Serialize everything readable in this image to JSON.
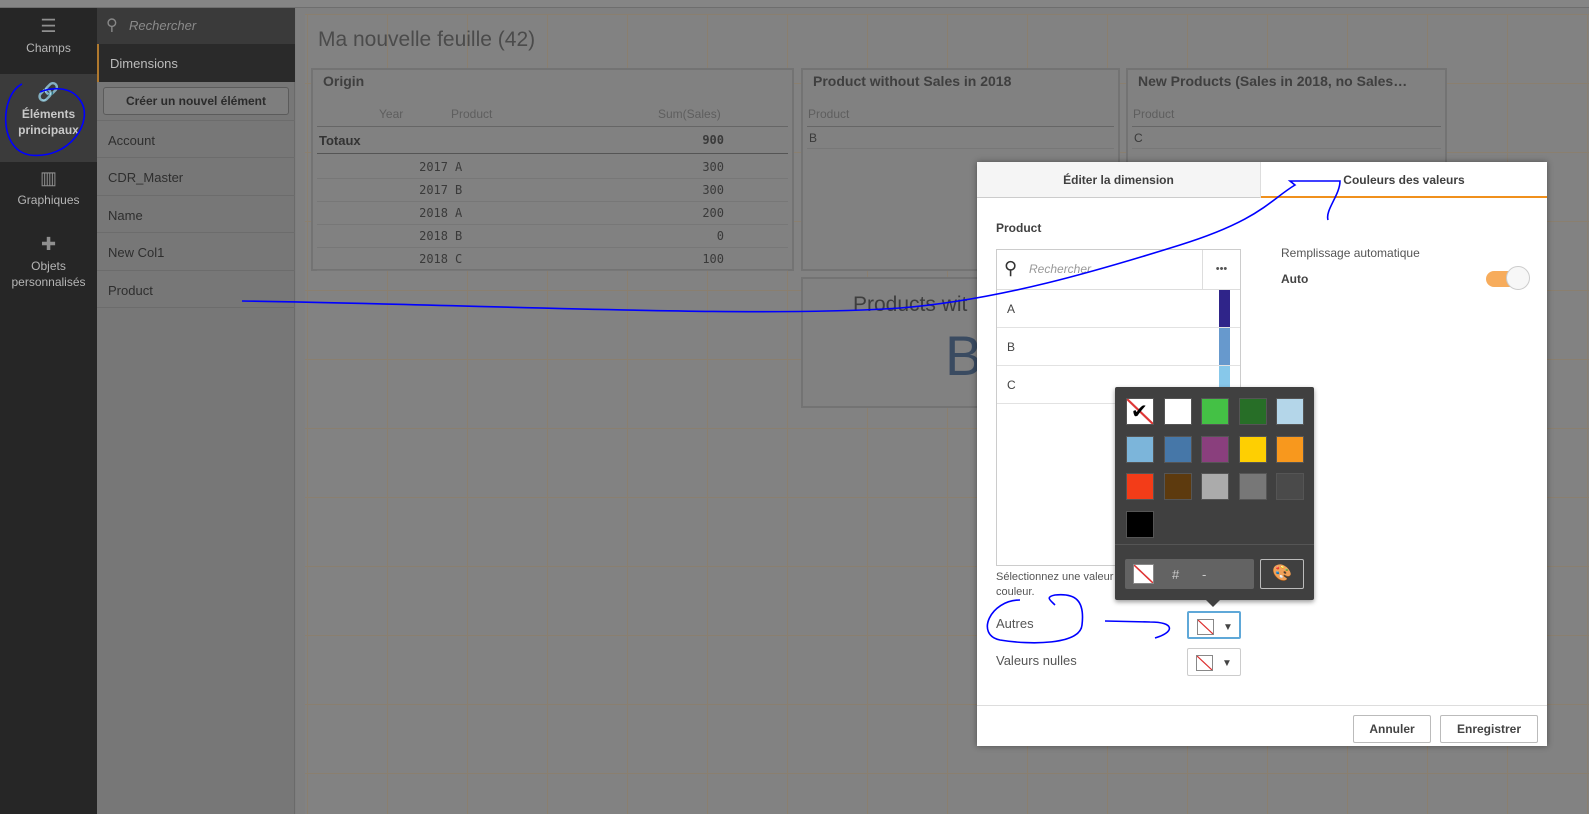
{
  "sidebar": {
    "items": [
      {
        "label": "Champs",
        "icon": "database-icon"
      },
      {
        "label": "Éléments principaux",
        "icon": "link-icon",
        "selected": true
      },
      {
        "label": "Graphiques",
        "icon": "bar-chart-icon"
      },
      {
        "label": "Objets personnalisés",
        "icon": "puzzle-icon"
      }
    ]
  },
  "panel": {
    "search_placeholder": "Rechercher",
    "section": "Dimensions",
    "create_label": "Créer un nouvel élément",
    "items": [
      "Account",
      "CDR_Master",
      "Name",
      "New Col1",
      "Product"
    ]
  },
  "sheet": {
    "title": "Ma nouvelle feuille (42)"
  },
  "origin": {
    "title": "Origin",
    "headers": [
      "Year",
      "Product",
      "Sum(Sales)"
    ],
    "totals_label": "Totaux",
    "totals_value": "900",
    "rows": [
      [
        "2017",
        "A",
        "300"
      ],
      [
        "2017",
        "B",
        "300"
      ],
      [
        "2018",
        "A",
        "200"
      ],
      [
        "2018",
        "B",
        "0"
      ],
      [
        "2018",
        "C",
        "100"
      ]
    ]
  },
  "no_sales": {
    "title": "Product without Sales in 2018",
    "header": "Product",
    "rows": [
      "B"
    ]
  },
  "new_products": {
    "title": "New Products (Sales in 2018, no Sales…",
    "header": "Product",
    "rows": [
      "C"
    ]
  },
  "kpi": {
    "title": "Products wit",
    "value": "B"
  },
  "dialog": {
    "tabs": [
      "Éditer la dimension",
      "Couleurs des valeurs"
    ],
    "active_tab": 1,
    "field": "Product",
    "search_placeholder": "Rechercher",
    "more": "•••",
    "values": [
      {
        "label": "A",
        "color": "#2f2489"
      },
      {
        "label": "B",
        "color": "#6799cd"
      },
      {
        "label": "C",
        "color": "#87c8ea"
      }
    ],
    "hint": "Sélectionnez une valeur couleur.",
    "hint_l1": "Sélectionnez une valeur",
    "hint_l2": "couleur.",
    "others_label": "Autres",
    "nulls_label": "Valeurs nulles",
    "auto_fill_label": "Remplissage automatique",
    "auto_label": "Auto",
    "auto_on": true,
    "cancel": "Annuler",
    "save": "Enregistrer"
  },
  "color_picker": {
    "swatches": [
      "none",
      "#ffffff",
      "#44c145",
      "#276e27",
      "#b4d6e9",
      "#7cb5da",
      "#4677a8",
      "#8a3f7d",
      "#fecf02",
      "#f8981d",
      "#f33c18",
      "#5d3a0e",
      "#ababab",
      "#777777",
      "#4a4a4a",
      "#000000"
    ],
    "selected": 0,
    "hex_prefix": "#",
    "hex_value": "-"
  },
  "colors": {
    "accent": "#f0901c",
    "annotation": "#0000ff"
  }
}
